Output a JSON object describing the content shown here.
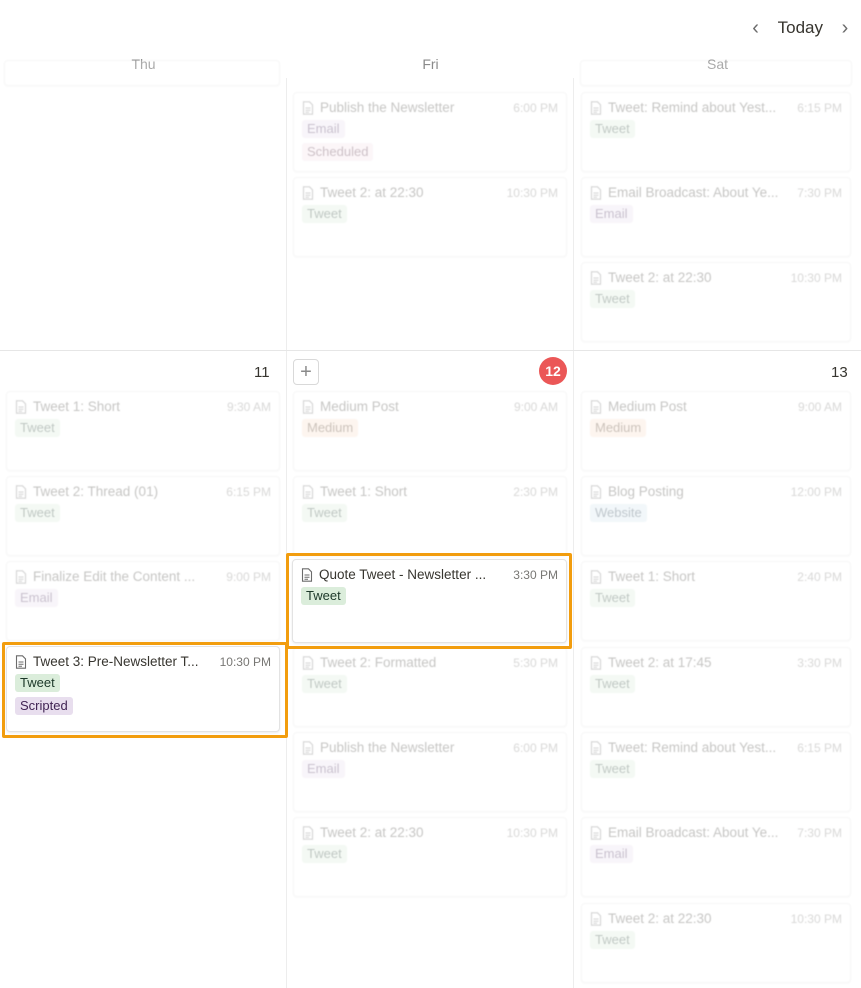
{
  "nav": {
    "today_label": "Today"
  },
  "weekdays": [
    "Thu",
    "Fri",
    "Sat"
  ],
  "week2": {
    "thu_num": "11",
    "fri_num": "12",
    "sat_num": "13"
  },
  "cards": {
    "w1_fri_1": {
      "title": "Publish the Newsletter",
      "time": "6:00 PM",
      "tags": [
        "Email",
        "Scheduled"
      ]
    },
    "w1_fri_2": {
      "title": "Tweet 2: at 22:30",
      "time": "10:30 PM",
      "tags": [
        "Tweet"
      ]
    },
    "w1_sat_1": {
      "title": "Tweet: Remind about Yest...",
      "time": "6:15 PM",
      "tags": [
        "Tweet"
      ]
    },
    "w1_sat_2": {
      "title": "Email Broadcast: About Ye...",
      "time": "7:30 PM",
      "tags": [
        "Email"
      ]
    },
    "w1_sat_3": {
      "title": "Tweet 2: at 22:30",
      "time": "10:30 PM",
      "tags": [
        "Tweet"
      ]
    },
    "w2_thu_1": {
      "title": "Tweet 1: Short",
      "time": "9:30 AM",
      "tags": [
        "Tweet"
      ]
    },
    "w2_thu_2": {
      "title": "Tweet 2: Thread (01)",
      "time": "6:15 PM",
      "tags": [
        "Tweet"
      ]
    },
    "w2_thu_3": {
      "title": "Finalize Edit the Content ...",
      "time": "9:00 PM",
      "tags": [
        "Email"
      ]
    },
    "w2_thu_4": {
      "title": "Tweet 3: Pre-Newsletter T...",
      "time": "10:30 PM",
      "tags": [
        "Tweet",
        "Scripted"
      ]
    },
    "w2_fri_1": {
      "title": "Medium Post",
      "time": "9:00 AM",
      "tags": [
        "Medium"
      ]
    },
    "w2_fri_2": {
      "title": "Tweet 1: Short",
      "time": "2:30 PM",
      "tags": [
        "Tweet"
      ]
    },
    "w2_fri_3": {
      "title": "Quote Tweet - Newsletter ...",
      "time": "3:30 PM",
      "tags": [
        "Tweet"
      ]
    },
    "w2_fri_4": {
      "title": "Tweet 2: Formatted",
      "time": "5:30 PM",
      "tags": [
        "Tweet"
      ]
    },
    "w2_fri_5": {
      "title": "Publish the Newsletter",
      "time": "6:00 PM",
      "tags": [
        "Email"
      ]
    },
    "w2_fri_6": {
      "title": "Tweet 2: at 22:30",
      "time": "10:30 PM",
      "tags": [
        "Tweet"
      ]
    },
    "w2_sat_1": {
      "title": "Medium Post",
      "time": "9:00 AM",
      "tags": [
        "Medium"
      ]
    },
    "w2_sat_2": {
      "title": "Blog Posting",
      "time": "12:00 PM",
      "tags": [
        "Website"
      ]
    },
    "w2_sat_3": {
      "title": "Tweet 1: Short",
      "time": "2:40 PM",
      "tags": [
        "Tweet"
      ]
    },
    "w2_sat_4": {
      "title": "Tweet 2: at 17:45",
      "time": "3:30 PM",
      "tags": [
        "Tweet"
      ]
    },
    "w2_sat_5": {
      "title": "Tweet: Remind about Yest...",
      "time": "6:15 PM",
      "tags": [
        "Tweet"
      ]
    },
    "w2_sat_6": {
      "title": "Email Broadcast: About Ye...",
      "time": "7:30 PM",
      "tags": [
        "Email"
      ]
    },
    "w2_sat_7": {
      "title": "Tweet 2: at 22:30",
      "time": "10:30 PM",
      "tags": [
        "Tweet"
      ]
    }
  },
  "tag_colors": {
    "Tweet": "green",
    "Email": "purple",
    "Scripted": "purple",
    "Scheduled": "pink",
    "Medium": "orange",
    "Website": "blue"
  },
  "colors": {
    "highlight": "#f29d0e",
    "today_badge": "#eb5757"
  }
}
